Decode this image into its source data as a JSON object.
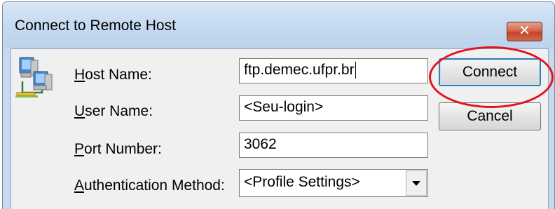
{
  "window": {
    "title": "Connect to Remote Host",
    "close_glyph": "✕"
  },
  "icon": {
    "name": "network-computers-icon"
  },
  "form": {
    "host_name": {
      "label_key": "H",
      "label_rest": "ost Name:",
      "value": "ftp.demec.ufpr.br"
    },
    "user_name": {
      "label_key": "U",
      "label_rest": "ser Name:",
      "value": "<Seu-login>"
    },
    "port_number": {
      "label_key": "P",
      "label_rest": "ort Number:",
      "value": "3062"
    },
    "auth_method": {
      "label_key": "A",
      "label_rest": "uthentication Method:",
      "value": "<Profile Settings>"
    }
  },
  "buttons": {
    "connect": "Connect",
    "cancel": "Cancel"
  },
  "colors": {
    "highlight_ring": "#e0141e",
    "title_bar": "#c7dbf1",
    "close_button": "#c2452a"
  }
}
